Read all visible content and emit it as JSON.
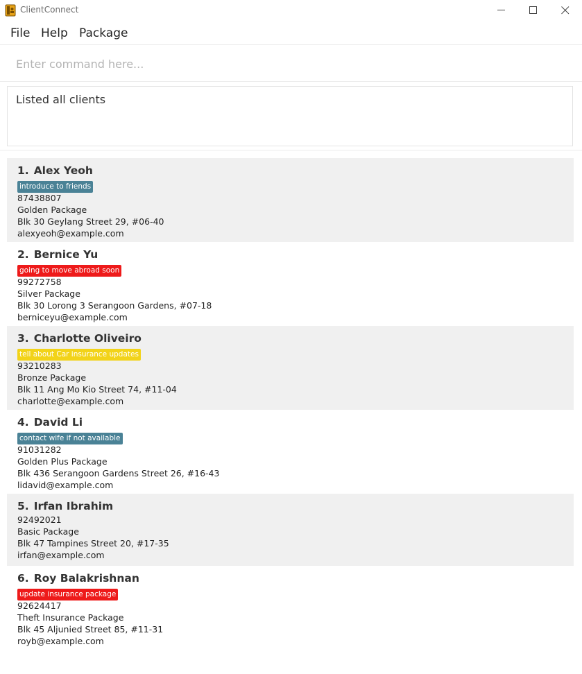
{
  "window": {
    "title": "ClientConnect"
  },
  "menu": {
    "file": "File",
    "help": "Help",
    "package": "Package"
  },
  "command": {
    "placeholder": "Enter command here...",
    "value": ""
  },
  "result": {
    "text": "Listed all clients"
  },
  "colors": {
    "tag_teal": "#4a8296",
    "tag_red": "#ee1a1a",
    "tag_yellow": "#f2d319",
    "row_alt": "#f0f0f0"
  },
  "clients": [
    {
      "index": "1.",
      "name": "Alex Yeoh",
      "tag": "introduce to friends",
      "tag_color": "teal",
      "phone": "87438807",
      "package": "Golden Package",
      "address": "Blk 30 Geylang Street 29, #06-40",
      "email": "alexyeoh@example.com"
    },
    {
      "index": "2.",
      "name": "Bernice Yu",
      "tag": "going to move abroad soon",
      "tag_color": "red",
      "phone": "99272758",
      "package": "Silver Package",
      "address": "Blk 30 Lorong 3 Serangoon Gardens, #07-18",
      "email": "berniceyu@example.com"
    },
    {
      "index": "3.",
      "name": "Charlotte Oliveiro",
      "tag": "tell about Car insurance updates",
      "tag_color": "yellow",
      "phone": "93210283",
      "package": "Bronze Package",
      "address": "Blk 11 Ang Mo Kio Street 74, #11-04",
      "email": "charlotte@example.com"
    },
    {
      "index": "4.",
      "name": "David Li",
      "tag": "contact wife if not available",
      "tag_color": "teal",
      "phone": "91031282",
      "package": "Golden Plus Package",
      "address": "Blk 436 Serangoon Gardens Street 26, #16-43",
      "email": "lidavid@example.com"
    },
    {
      "index": "5.",
      "name": "Irfan Ibrahim",
      "tag": "",
      "tag_color": "",
      "phone": "92492021",
      "package": "Basic Package",
      "address": "Blk 47 Tampines Street 20, #17-35",
      "email": "irfan@example.com"
    },
    {
      "index": "6.",
      "name": "Roy Balakrishnan",
      "tag": "update insurance package",
      "tag_color": "red",
      "phone": "92624417",
      "package": "Theft Insurance Package",
      "address": "Blk 45 Aljunied Street 85, #11-31",
      "email": "royb@example.com"
    }
  ]
}
